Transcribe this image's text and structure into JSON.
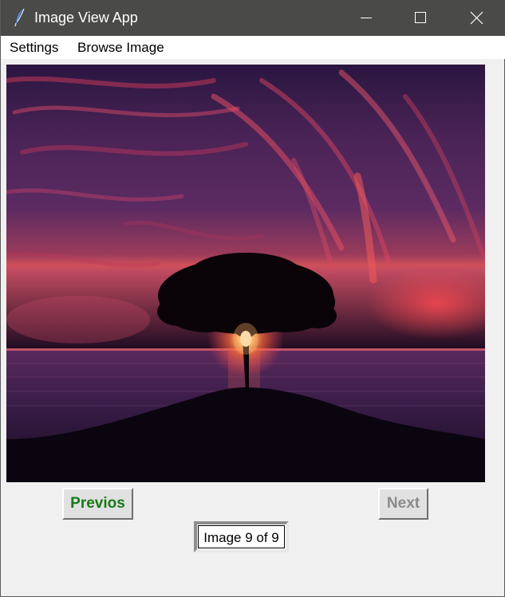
{
  "window": {
    "title": "Image View App",
    "app_icon": "feather-icon",
    "controls": {
      "minimize_icon": "minimize-icon",
      "maximize_icon": "maximize-icon",
      "close_icon": "close-icon"
    }
  },
  "menubar": {
    "items": [
      {
        "label": "Settings"
      },
      {
        "label": "Browse Image"
      }
    ]
  },
  "viewer": {
    "image_subject": "lone tree silhouette on a hill at sunset over the sea under red clouds"
  },
  "navigation": {
    "previous_label": "Previos",
    "next_label": "Next",
    "previous_color": "#177a17",
    "next_color": "#8a8a8a",
    "next_disabled": true
  },
  "status": {
    "text": "Image 9 of 9"
  },
  "colors": {
    "titlebar": "#4a4a48",
    "window_bg": "#f0f0f0",
    "menubar_bg": "#ffffff"
  }
}
